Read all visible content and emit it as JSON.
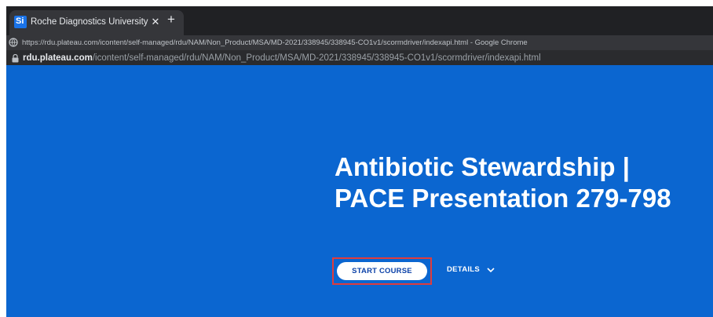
{
  "browser": {
    "tab": {
      "title": "Roche Diagnostics University – ⁠",
      "favicon_text": "Si",
      "close_icon": "close-icon"
    },
    "new_tab_icon": "plus-icon",
    "window_title": "https://rdu.plateau.com/icontent/self-managed/rdu/NAM/Non_Product/MSA/MD-2021/338945/338945-CO1v1/scormdriver/indexapi.html - Google Chrome",
    "address": {
      "host": "rdu.plateau.com",
      "path": "/icontent/self-managed/rdu/NAM/Non_Product/MSA/MD-2021/338945/338945-CO1v1/scormdriver/indexapi.html"
    }
  },
  "course": {
    "title_line1": "Antibiotic Stewardship |",
    "title_line2": "PACE Presentation 279-798",
    "start_label": "START COURSE",
    "details_label": "DETAILS"
  },
  "colors": {
    "page_background": "#0b66d0",
    "highlight_border": "#e03c3c",
    "button_text": "#0b41a8"
  }
}
